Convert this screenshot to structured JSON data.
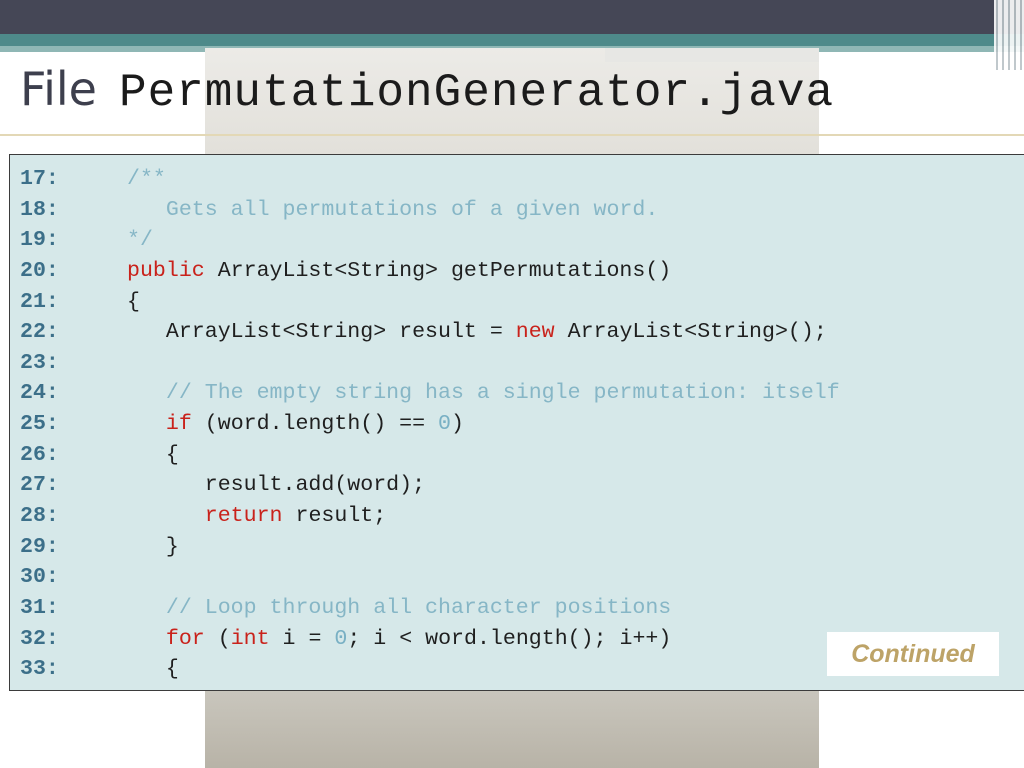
{
  "slide": {
    "title_word": "File",
    "title_code": "PermutationGenerator.java",
    "continued_label": "Continued"
  },
  "colors": {
    "top_band": "#454756",
    "teal_band": "#4e8a8a",
    "panel_bg": "#d6e8e9",
    "line_number": "#3c6f89",
    "keyword": "#c9221b",
    "comment": "#86b6c6",
    "continued": "#bda367"
  },
  "code": {
    "lines": [
      {
        "no": "17:",
        "segments": [
          {
            "t": "/**",
            "c": "cm"
          }
        ]
      },
      {
        "no": "18:",
        "segments": [
          {
            "t": "   Gets all permutations of a given word.",
            "c": "cm"
          }
        ]
      },
      {
        "no": "19:",
        "segments": [
          {
            "t": "*/",
            "c": "cm"
          }
        ]
      },
      {
        "no": "20:",
        "segments": [
          {
            "t": "public",
            "c": "kw"
          },
          {
            "t": " ArrayList<String> getPermutations()",
            "c": ""
          }
        ]
      },
      {
        "no": "21:",
        "segments": [
          {
            "t": "{",
            "c": ""
          }
        ]
      },
      {
        "no": "22:",
        "segments": [
          {
            "t": "   ArrayList<String> result = ",
            "c": ""
          },
          {
            "t": "new",
            "c": "kw"
          },
          {
            "t": " ArrayList<String>();",
            "c": ""
          }
        ]
      },
      {
        "no": "23:",
        "segments": []
      },
      {
        "no": "24:",
        "segments": [
          {
            "t": "   // The empty string has a single permutation: itself",
            "c": "cm"
          }
        ]
      },
      {
        "no": "25:",
        "segments": [
          {
            "t": "   ",
            "c": ""
          },
          {
            "t": "if",
            "c": "kw"
          },
          {
            "t": " (word.length() == ",
            "c": ""
          },
          {
            "t": "0",
            "c": "num"
          },
          {
            "t": ")",
            "c": ""
          }
        ]
      },
      {
        "no": "26:",
        "segments": [
          {
            "t": "   {",
            "c": ""
          }
        ]
      },
      {
        "no": "27:",
        "segments": [
          {
            "t": "      result.add(word);",
            "c": ""
          }
        ]
      },
      {
        "no": "28:",
        "segments": [
          {
            "t": "      ",
            "c": ""
          },
          {
            "t": "return",
            "c": "kw"
          },
          {
            "t": " result;",
            "c": ""
          }
        ]
      },
      {
        "no": "29:",
        "segments": [
          {
            "t": "   }",
            "c": ""
          }
        ]
      },
      {
        "no": "30:",
        "segments": []
      },
      {
        "no": "31:",
        "segments": [
          {
            "t": "   // Loop through all character positions",
            "c": "cm"
          }
        ]
      },
      {
        "no": "32:",
        "segments": [
          {
            "t": "   ",
            "c": ""
          },
          {
            "t": "for",
            "c": "kw"
          },
          {
            "t": " (",
            "c": ""
          },
          {
            "t": "int",
            "c": "kw"
          },
          {
            "t": " i = ",
            "c": ""
          },
          {
            "t": "0",
            "c": "num"
          },
          {
            "t": "; i < word.length(); i++)",
            "c": ""
          }
        ]
      },
      {
        "no": "33:",
        "segments": [
          {
            "t": "   {",
            "c": ""
          }
        ]
      }
    ]
  }
}
